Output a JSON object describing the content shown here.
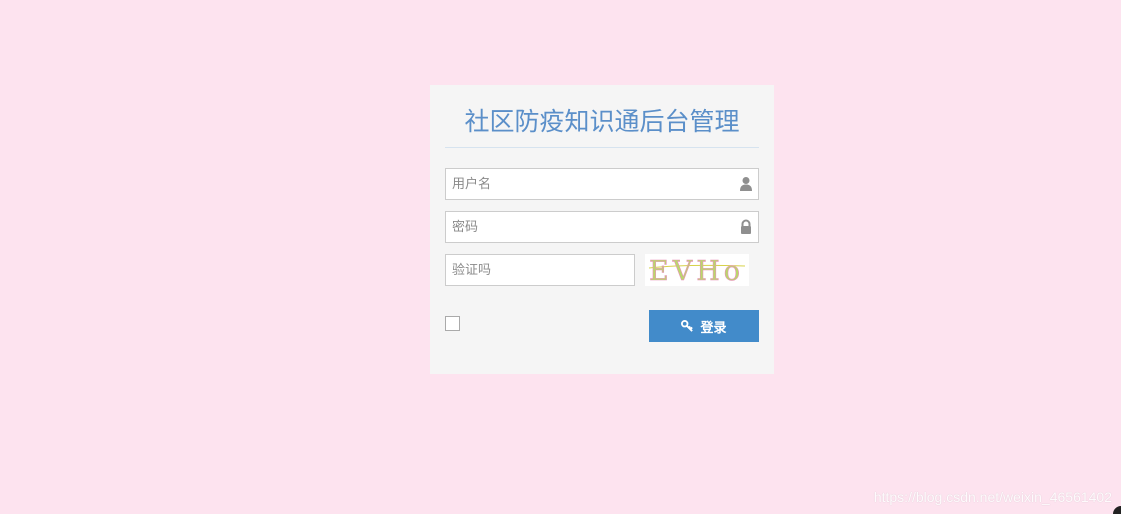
{
  "login": {
    "title": "社区防疫知识通后台管理",
    "username_placeholder": "用户名",
    "password_placeholder": "密码",
    "captcha_placeholder": "验证吗",
    "captcha_text": "EVHo",
    "login_label": "登录"
  },
  "icons": {
    "username": "user-icon",
    "password": "lock-icon",
    "login": "key-icon"
  },
  "colors": {
    "background": "#fde3ef",
    "panel": "#f5f5f5",
    "title": "#5b8fc9",
    "button": "#428bca"
  },
  "watermark": "https://blog.csdn.net/weixin_46561402"
}
